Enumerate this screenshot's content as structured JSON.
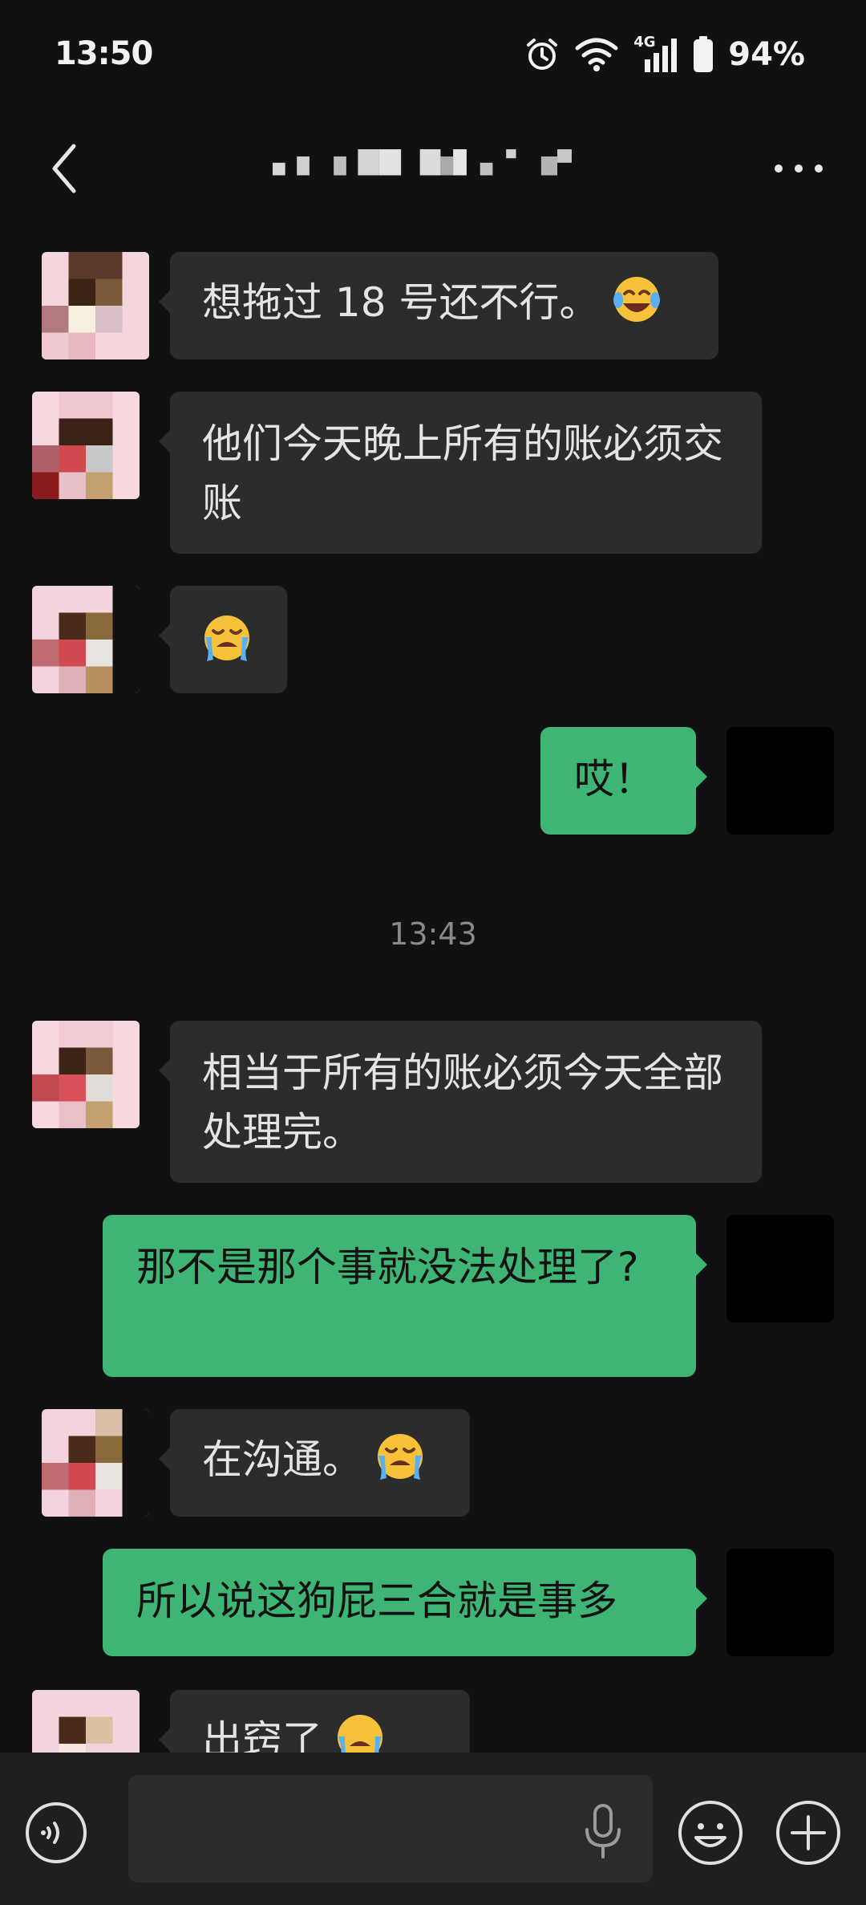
{
  "status_bar": {
    "time": "13:50",
    "network": "4G",
    "battery": "94%"
  },
  "header": {
    "back_icon": "chevron-left-icon",
    "more_icon": "more-dots-icon"
  },
  "messages": [
    {
      "dir": "in",
      "text": "想拖过 18 号还不行。",
      "emoji": "tears-of-joy"
    },
    {
      "dir": "in",
      "text": "他们今天晚上所有的账必须交账",
      "emoji": ""
    },
    {
      "dir": "in",
      "text": "",
      "emoji": "loudly-crying"
    },
    {
      "dir": "out",
      "text": "哎！",
      "emoji": ""
    },
    {
      "dir": "in",
      "text": "相当于所有的账必须今天全部处理完。",
      "emoji": ""
    },
    {
      "dir": "out",
      "text": "那不是那个事就没法处理了?",
      "emoji": ""
    },
    {
      "dir": "in",
      "text": "在沟通。",
      "emoji": "loudly-crying"
    },
    {
      "dir": "out",
      "text": "所以说这狗屁三合就是事多",
      "emoji": ""
    },
    {
      "dir": "in",
      "text": "出窍了",
      "emoji": "loudly-crying"
    }
  ],
  "timestamp": "13:43",
  "input_bar": {
    "placeholder": "",
    "voice_icon": "voice-icon",
    "mic_icon": "mic-icon",
    "emoji_icon": "emoji-icon",
    "plus_icon": "plus-icon"
  },
  "colors": {
    "background": "#111111",
    "incoming_bubble": "#2c2c2c",
    "outgoing_bubble": "#3eb575"
  }
}
